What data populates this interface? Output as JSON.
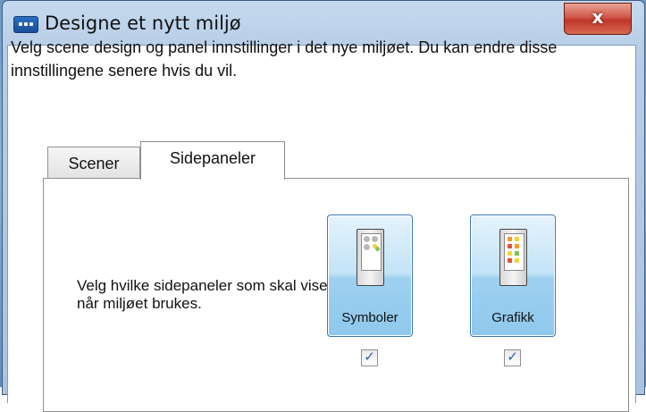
{
  "window": {
    "title": "Designe et nytt miljø",
    "close_glyph": "x"
  },
  "description": "Velg scene design og panel innstillinger i det nye miljøet. Du kan endre disse innstillingene senere hvis du vil.",
  "tabs": [
    {
      "label": "Scener",
      "selected": false
    },
    {
      "label": "Sidepaneler",
      "selected": true
    }
  ],
  "sidepanels": {
    "instruction": "Velg hvilke sidepaneler som skal vises når miljøet brukes.",
    "options": [
      {
        "label": "Symboler",
        "icon": "symbols-panel-icon",
        "checked": true,
        "check_glyph": "✓"
      },
      {
        "label": "Grafikk",
        "icon": "graphics-panel-icon",
        "checked": true,
        "check_glyph": "✓"
      }
    ]
  },
  "colors": {
    "tile_border": "#3b79b5",
    "close_red": "#c2352a",
    "title_bar": "#c5d9ee"
  }
}
